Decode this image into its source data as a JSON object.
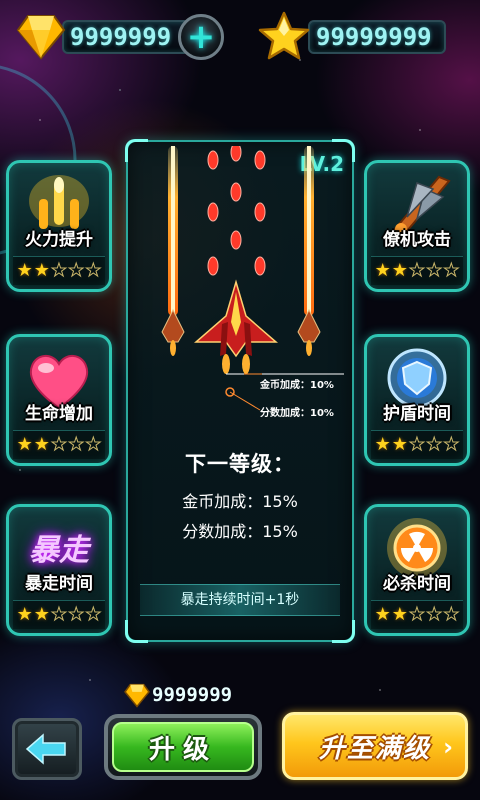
{
  "currency": {
    "gems": "9999999",
    "stars": "99999999"
  },
  "cards": [
    {
      "label": "火力提升",
      "stars_on": 2,
      "stars_total": 5,
      "icon": "firepower-icon"
    },
    {
      "label": "僚机攻击",
      "stars_on": 2,
      "stars_total": 5,
      "icon": "wingman-icon"
    },
    {
      "label": "生命增加",
      "stars_on": 2,
      "stars_total": 5,
      "icon": "heart-icon"
    },
    {
      "label": "护盾时间",
      "stars_on": 2,
      "stars_total": 5,
      "icon": "shield-icon"
    },
    {
      "label": "暴走时间",
      "stars_on": 2,
      "stars_total": 5,
      "icon": "rage-icon",
      "art_text": "暴走"
    },
    {
      "label": "必杀时间",
      "stars_on": 2,
      "stars_total": 5,
      "icon": "nuke-icon"
    }
  ],
  "panel": {
    "level": "LV.2",
    "coin_bonus": "金币加成：10%",
    "score_bonus": "分数加成：10%",
    "next_title": "下一等级：",
    "next_coin": "金币加成：15%",
    "next_score": "分数加成：15%",
    "rage_text": "暴走持续时间+1秒"
  },
  "bottom": {
    "cost": "9999999",
    "upgrade_label": "升级",
    "max_label": "升至满级"
  },
  "colors": {
    "accent": "#2fc6b3",
    "gold": "#ffd21e",
    "green": "#37b81f"
  }
}
